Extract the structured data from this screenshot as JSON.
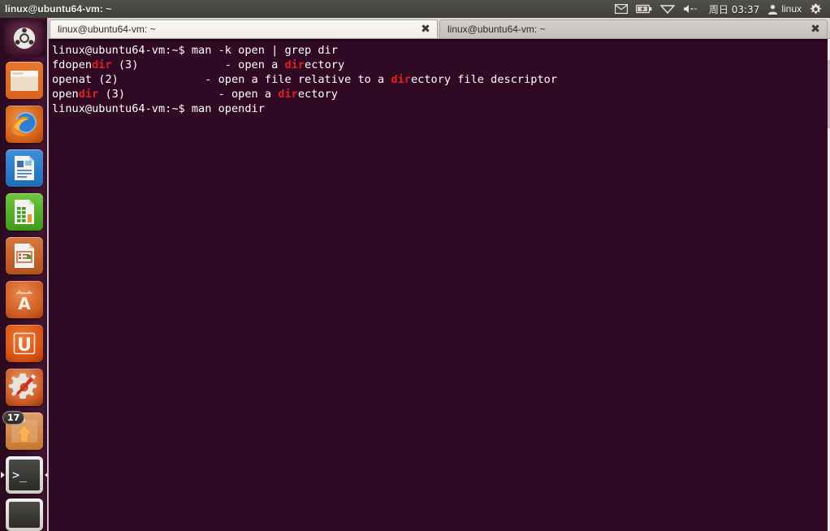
{
  "panel": {
    "window_title": "linux@ubuntu64-vm: ~",
    "clock": "周日 03:37",
    "user_name": "linux",
    "tray_icons": [
      "mail-icon",
      "battery-icon",
      "wifi-icon",
      "volume-icon"
    ],
    "session_icon": "gear-icon",
    "user_icon": "user-icon"
  },
  "launcher": {
    "items": [
      {
        "name": "dash-home",
        "label": "Dash home",
        "icon": "ubuntu-logo-icon"
      },
      {
        "name": "files",
        "label": "Files",
        "icon": "folder-icon"
      },
      {
        "name": "firefox",
        "label": "Firefox Web Browser",
        "icon": "firefox-icon"
      },
      {
        "name": "libreoffice-writer",
        "label": "LibreOffice Writer",
        "icon": "document-icon"
      },
      {
        "name": "libreoffice-calc",
        "label": "LibreOffice Calc",
        "icon": "spreadsheet-icon"
      },
      {
        "name": "libreoffice-impress",
        "label": "LibreOffice Impress",
        "icon": "presentation-icon"
      },
      {
        "name": "software-center",
        "label": "Ubuntu Software Center",
        "icon": "letter-a-icon"
      },
      {
        "name": "ubuntu-one",
        "label": "Ubuntu One",
        "icon": "letter-u-icon"
      },
      {
        "name": "system-settings",
        "label": "System Settings",
        "icon": "gear-wrench-icon"
      },
      {
        "name": "software-updater",
        "label": "Software Updater",
        "icon": "upload-arrow-icon",
        "badge": "17"
      },
      {
        "name": "terminal",
        "label": "Terminal",
        "icon": "terminal-prompt-icon",
        "running": true
      }
    ]
  },
  "terminal": {
    "tabs": [
      {
        "label": "linux@ubuntu64-vm: ~",
        "active": true,
        "close_icon": "✖"
      },
      {
        "label": "linux@ubuntu64-vm: ~",
        "active": false,
        "close_icon": "✖"
      }
    ],
    "colors": {
      "background": "#300a24",
      "foreground": "#ffffff",
      "grep_match": "#e02020"
    },
    "lines": [
      [
        {
          "t": "linux@ubuntu64-vm:~$ man -k open | grep dir",
          "c": "white"
        }
      ],
      [
        {
          "t": "fdopen",
          "c": "white"
        },
        {
          "t": "dir",
          "c": "red"
        },
        {
          "t": " (3)             - open a ",
          "c": "white"
        },
        {
          "t": "dir",
          "c": "red"
        },
        {
          "t": "ectory",
          "c": "white"
        }
      ],
      [
        {
          "t": "openat (2)             - open a file relative to a ",
          "c": "white"
        },
        {
          "t": "dir",
          "c": "red"
        },
        {
          "t": "ectory file descriptor",
          "c": "white"
        }
      ],
      [
        {
          "t": "open",
          "c": "white"
        },
        {
          "t": "dir",
          "c": "red"
        },
        {
          "t": " (3)              - open a ",
          "c": "white"
        },
        {
          "t": "dir",
          "c": "red"
        },
        {
          "t": "ectory",
          "c": "white"
        }
      ],
      [
        {
          "t": "linux@ubuntu64-vm:~$ man opendir",
          "c": "white"
        }
      ]
    ]
  }
}
